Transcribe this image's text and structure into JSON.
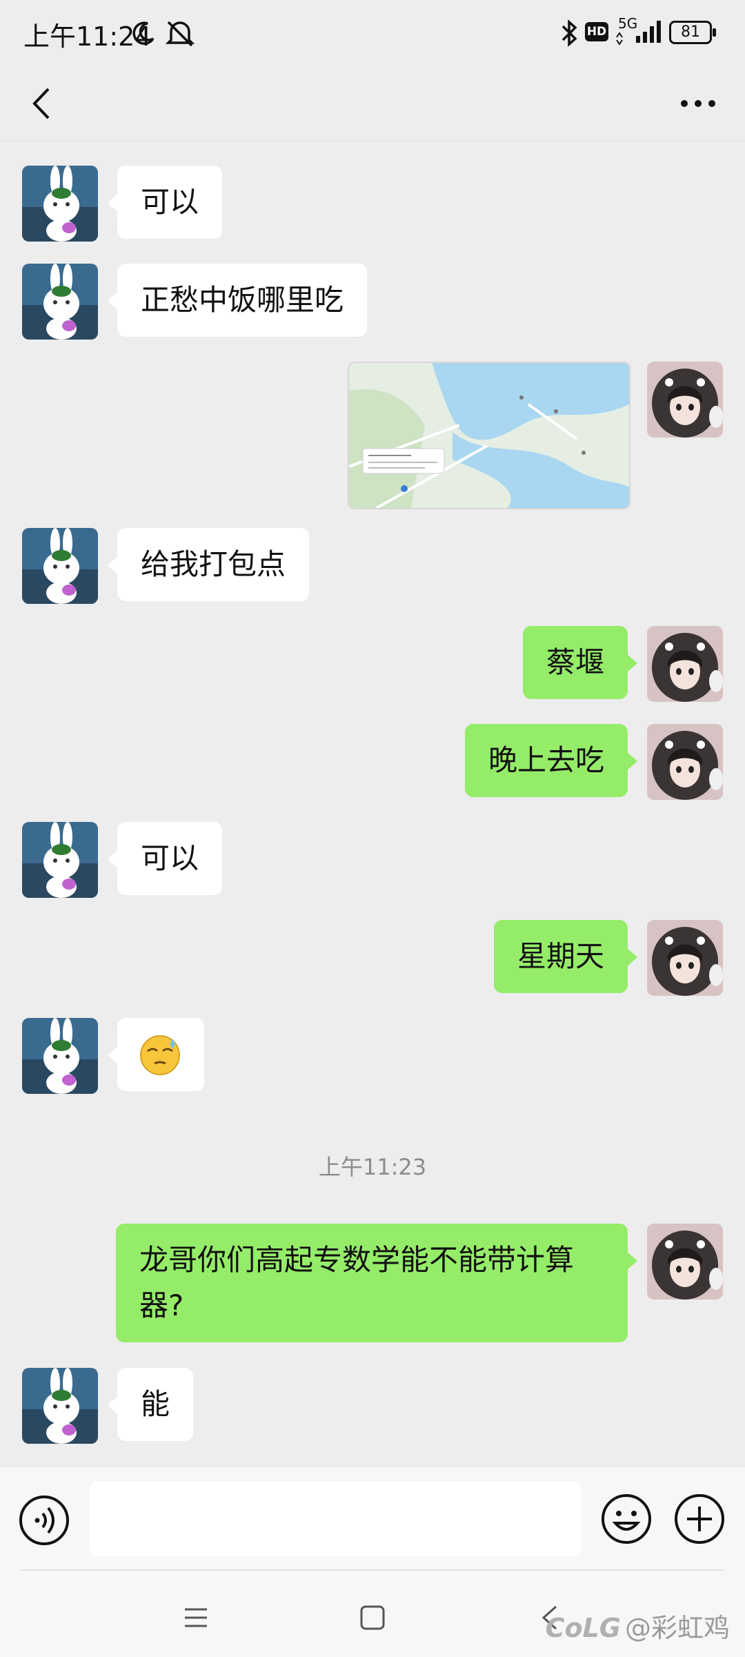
{
  "status_bar": {
    "time": "上午11:24",
    "network": "5G",
    "hd_badge": "HD",
    "battery": "81"
  },
  "messages": [
    {
      "side": "in",
      "text": "可以"
    },
    {
      "side": "in",
      "text": "正愁中饭哪里吃"
    },
    {
      "side": "out",
      "type": "location-map"
    },
    {
      "side": "in",
      "text": "给我打包点"
    },
    {
      "side": "out",
      "text": "蔡堰"
    },
    {
      "side": "out",
      "text": "晚上去吃"
    },
    {
      "side": "in",
      "text": "可以"
    },
    {
      "side": "out",
      "text": "星期天"
    },
    {
      "side": "in",
      "type": "emoji",
      "emoji": "sweat-smile-emoji"
    },
    {
      "type": "timestamp",
      "text": "上午11:23"
    },
    {
      "side": "out",
      "text": "龙哥你们高起专数学能不能带计算器?"
    },
    {
      "side": "in",
      "text": "能"
    }
  ],
  "input_bar": {
    "placeholder": ""
  },
  "watermark": "@彩虹鸡",
  "watermark_logo": "CoLG"
}
